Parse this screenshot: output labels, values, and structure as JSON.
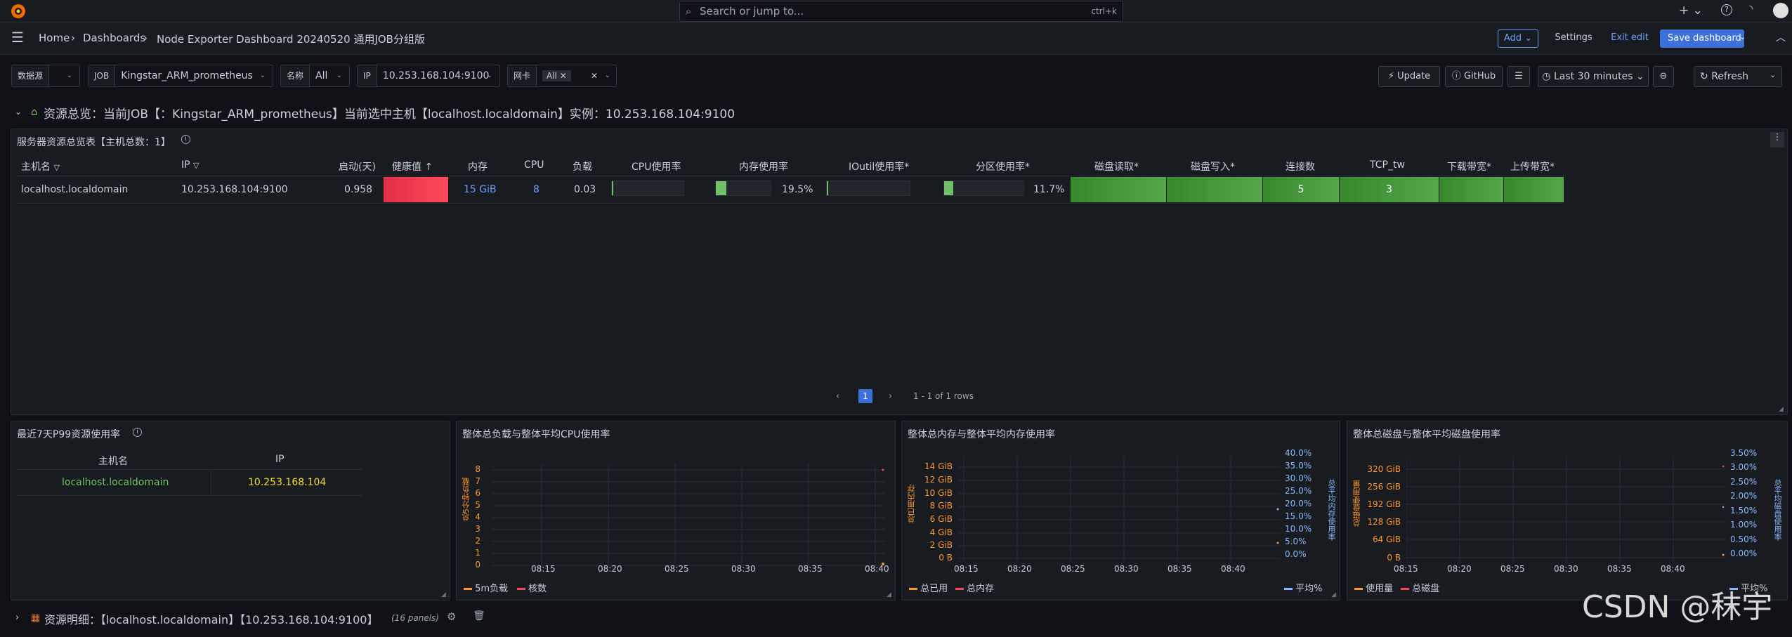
{
  "topbar": {
    "search_placeholder": "Search or jump to...",
    "search_shortcut": "ctrl+k"
  },
  "breadcrumb": {
    "home": "Home",
    "dashboards": "Dashboards",
    "current": "Node Exporter Dashboard 20240520 通用JOB分组版"
  },
  "actions": {
    "add": "Add",
    "settings": "Settings",
    "exit_edit": "Exit edit",
    "save": "Save dashboard"
  },
  "variables": [
    {
      "label": "数据源",
      "value": ""
    },
    {
      "label": "JOB",
      "value": "Kingstar_ARM_prometheus"
    },
    {
      "label": "名称",
      "value": "All"
    },
    {
      "label": "IP",
      "value": "10.253.168.104:9100"
    },
    {
      "label": "网卡",
      "value": "All"
    }
  ],
  "toolbar": {
    "update": "Update",
    "github": "GitHub",
    "time_range": "Last 30 minutes",
    "refresh": "Refresh"
  },
  "row1_title": "资源总览：当前JOB【：Kingstar_ARM_prometheus】当前选中主机【localhost.localdomain】实例：10.253.168.104:9100",
  "row2_title": "资源明细：【localhost.localdomain】【10.253.168.104:9100】",
  "row2_count": "(16 panels)",
  "overview_panel": {
    "title": "服务器资源总览表【主机总数：1】",
    "columns": [
      "主机名",
      "IP",
      "启动(天)",
      "健康值",
      "内存",
      "CPU",
      "负载",
      "CPU使用率",
      "内存使用率",
      "IOutil使用率*",
      "分区使用率*",
      "磁盘读取*",
      "磁盘写入*",
      "连接数",
      "TCP_tw",
      "下载带宽*",
      "上传带宽*"
    ],
    "row": {
      "host": "localhost.localdomain",
      "ip": "10.253.168.104:9100",
      "uptime": "0.958",
      "health": "",
      "mem": "15 GiB",
      "cpu": "8",
      "load": "0.03",
      "cpu_pct": 0.01,
      "mem_pct_label": "19.5%",
      "mem_pct": 0.195,
      "io_pct": 0.005,
      "part_pct_label": "11.7%",
      "part_pct": 0.117,
      "disk_read": "",
      "disk_write": "",
      "conn": "5",
      "tcp_tw": "3",
      "down": "",
      "up": ""
    },
    "page": "1",
    "rows_info": "1 - 1 of 1 rows"
  },
  "p99_panel": {
    "title": "最近7天P99资源使用率",
    "columns": [
      "主机名",
      "IP"
    ],
    "row": {
      "host": "localhost.localdomain",
      "ip": "10.253.168.104"
    }
  },
  "cpu_panel": {
    "title": "整体总负载与整体平均CPU使用率",
    "y_label": "总5分钟负载",
    "y_ticks": [
      "8",
      "7",
      "6",
      "5",
      "4",
      "3",
      "2",
      "1",
      "0"
    ],
    "x_ticks": [
      "08:15",
      "08:20",
      "08:25",
      "08:30",
      "08:35",
      "08:40"
    ],
    "legend": [
      "5m负载",
      "核数"
    ]
  },
  "mem_panel": {
    "title": "整体总内存与整体平均内存使用率",
    "y_label": "总已用内存",
    "y2_label": "总平均内存使用率",
    "y_ticks": [
      "14 GiB",
      "12 GiB",
      "10 GiB",
      "8 GiB",
      "6 GiB",
      "4 GiB",
      "2 GiB",
      "0 B"
    ],
    "y2_ticks": [
      "40.0%",
      "35.0%",
      "30.0%",
      "25.0%",
      "20.0%",
      "15.0%",
      "10.0%",
      "5.0%",
      "0.0%"
    ],
    "x_ticks": [
      "08:15",
      "08:20",
      "08:25",
      "08:30",
      "08:35",
      "08:40"
    ],
    "legend": [
      "总已用",
      "总内存"
    ],
    "legend_right": "平均%"
  },
  "disk_panel": {
    "title": "整体总磁盘与整体平均磁盘使用率",
    "y_label": "总磁盘使用量",
    "y2_label": "总平均磁盘使用率",
    "y_ticks": [
      "320 GiB",
      "256 GiB",
      "192 GiB",
      "128 GiB",
      "64 GiB",
      "0 B"
    ],
    "y2_ticks": [
      "3.50%",
      "3.00%",
      "2.50%",
      "2.00%",
      "1.50%",
      "1.00%",
      "0.50%",
      "0.00%"
    ],
    "x_ticks": [
      "08:15",
      "08:20",
      "08:25",
      "08:30",
      "08:35",
      "08:40"
    ],
    "legend": [
      "使用量",
      "总磁盘"
    ],
    "legend_right": "平均%"
  },
  "watermark": "CSDN @秣宇",
  "colors": {
    "accent": "#3d71d9",
    "green": "#37872d",
    "red": "#f2495c",
    "orange": "#ff9830",
    "yellow": "#fade2a"
  }
}
